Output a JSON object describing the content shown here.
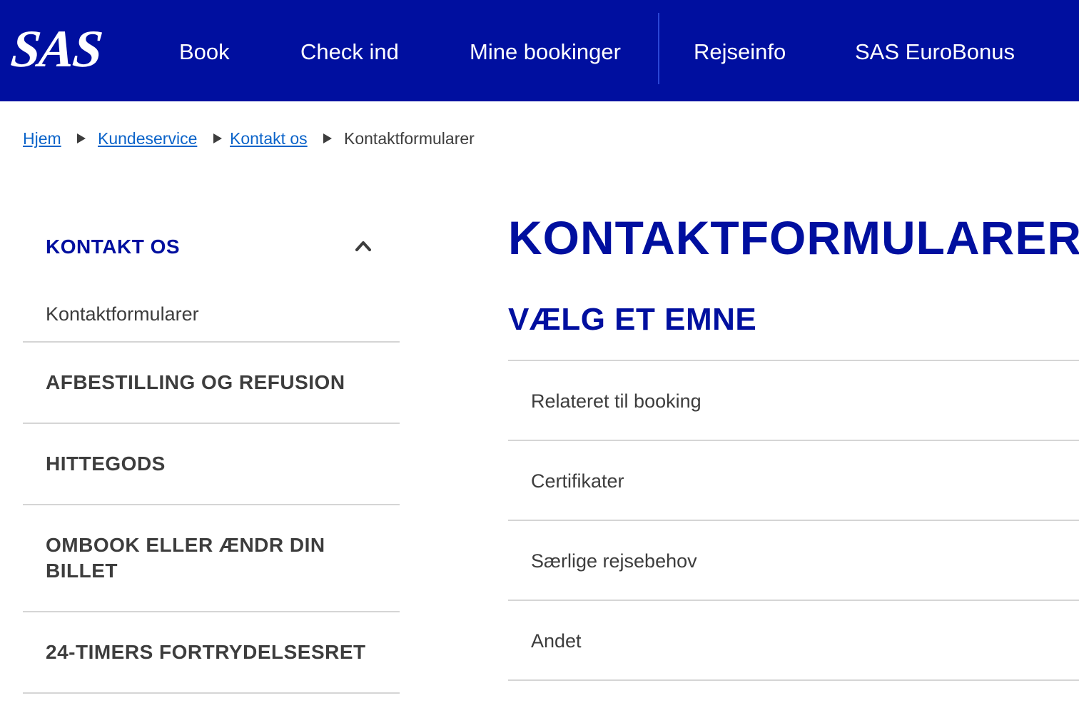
{
  "header": {
    "logo_text": "SAS",
    "nav": [
      "Book",
      "Check ind",
      "Mine bookinger",
      "Rejseinfo",
      "SAS EuroBonus"
    ],
    "background": "#000f9f"
  },
  "breadcrumb": {
    "links": [
      "Hjem",
      "Kundeservice",
      "Kontakt os"
    ],
    "current": "Kontaktformularer",
    "separator_icon": "triangle-right-icon"
  },
  "sidebar": {
    "title": "KONTAKT OS",
    "toggle_icon": "chevron-up-icon",
    "active_item": "Kontaktformularer",
    "items": [
      "AFBESTILLING OG REFUSION",
      "HITTEGODS",
      "OMBOOK ELLER ÆNDR DIN BILLET",
      "24-TIMERS FORTRYDELSESRET"
    ]
  },
  "main": {
    "title": "KONTAKTFORMULARER",
    "subtitle": "VÆLG ET EMNE",
    "topics": [
      "Relateret til booking",
      "Certifikater",
      "Særlige rejsebehov",
      "Andet"
    ]
  },
  "colors": {
    "brand_blue": "#000f9f",
    "link": "#0a63c9",
    "text": "#3d3d3d",
    "divider": "#d5d5d5"
  }
}
